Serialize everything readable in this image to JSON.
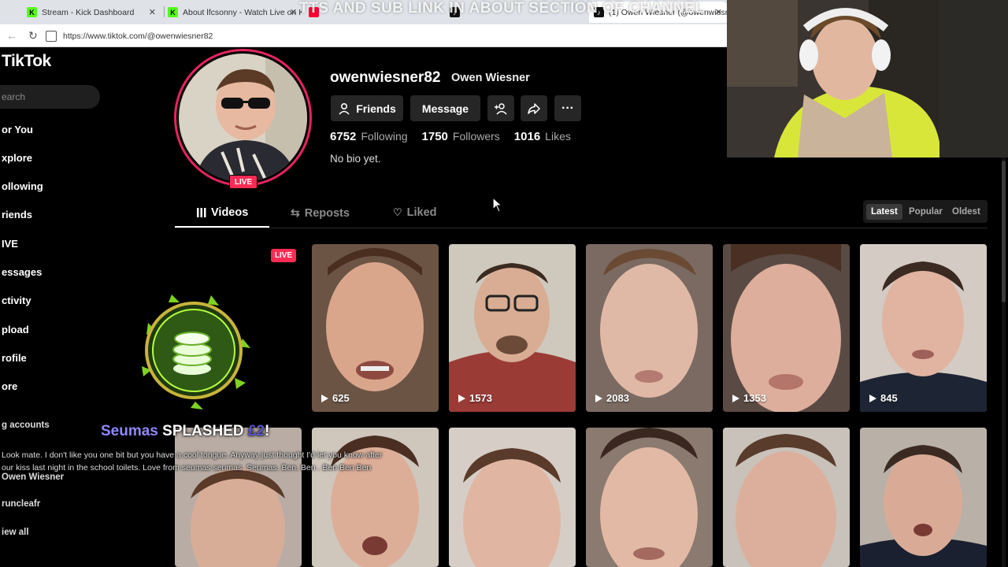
{
  "browser": {
    "tabs": [
      {
        "title": "Stream - Kick Dashboard",
        "favicon": "kick-icon",
        "color": "#53fc18"
      },
      {
        "title": "About lfcsonny - Watch Live on Ki",
        "favicon": "kick-icon",
        "color": "#53fc18"
      },
      {
        "title": "",
        "favicon": "youtube-icon",
        "color": "#ff0033"
      },
      {
        "title": "",
        "favicon": "tiktok-icon",
        "color": "#ffffff"
      },
      {
        "title": "(1) Owen Wiesner (@owenwiesne",
        "favicon": "tiktok-icon",
        "color": "#ffffff",
        "active": true
      }
    ],
    "overlay_banner": "TTS AND SUB LINK IN ABOUT SECTION OF CHANNEL",
    "url": "https://www.tiktok.com/@owenwiesner82"
  },
  "sidebar": {
    "logo": "TikTok",
    "search_placeholder": "earch",
    "items": [
      "or You",
      "xplore",
      "ollowing",
      "riends",
      "IVE",
      "essages",
      "ctivity",
      "pload",
      "rofile",
      "ore"
    ],
    "following_accounts_label": "g accounts",
    "accounts": [
      "Owen Wiesner",
      "runcleafr"
    ],
    "see_all": "iew all"
  },
  "profile": {
    "username": "owenwiesner82",
    "nickname": "Owen Wiesner",
    "live_label": "LIVE",
    "buttons": {
      "friends": "Friends",
      "message": "Message"
    },
    "stats": {
      "following_count": "6752",
      "following_label": "Following",
      "followers_count": "1750",
      "followers_label": "Followers",
      "likes_count": "1016",
      "likes_label": "Likes"
    },
    "bio": "No bio yet."
  },
  "content_tabs": [
    "Videos",
    "Reposts",
    "Liked"
  ],
  "sort_options": [
    "Latest",
    "Popular",
    "Oldest"
  ],
  "grid_live_label": "LIVE",
  "videos_row1": [
    {
      "views": "625"
    },
    {
      "views": "1573"
    },
    {
      "views": "2083"
    },
    {
      "views": "1353"
    },
    {
      "views": "845"
    }
  ],
  "alert": {
    "donor": "Seumas",
    "action": "SPLASHED",
    "amount": "£2",
    "exclaim": "!",
    "message": "Look mate. I don't like you one bit but you have a cool tongue. Anyway just thought I'd let you know after our kiss last night in the school toilets. Love from seumas seumas. Seumas. Ben. Ben . Ben Ben Ben"
  },
  "colors": {
    "accent": "#fe2c55",
    "splash_name": "#8f88ff",
    "coin_glow": "#b6ff3d"
  }
}
